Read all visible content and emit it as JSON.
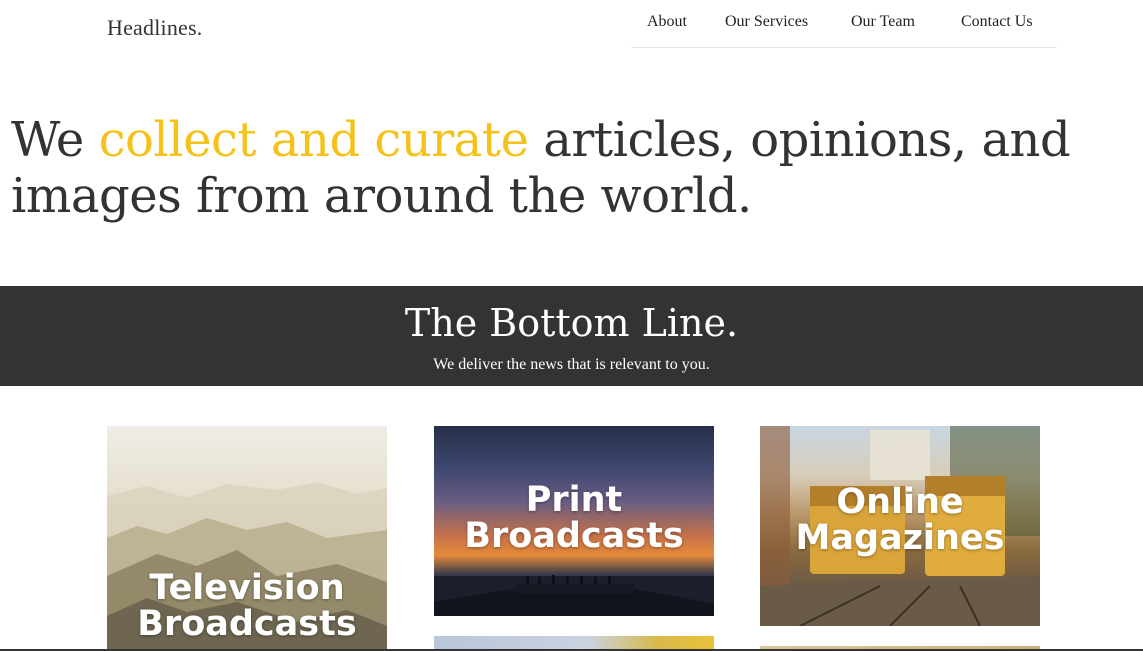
{
  "header": {
    "brand": "Headlines.",
    "nav": [
      "About",
      "Our Services",
      "Our Team",
      "Contact Us"
    ]
  },
  "hero": {
    "before": "We ",
    "accent": "collect and curate",
    "after": " articles, opinions, and images from around the world.",
    "accent_color": "#f5c21b"
  },
  "band": {
    "title": "The Bottom Line.",
    "subtitle": "We deliver the news that is relevant to you.",
    "background": "#333333"
  },
  "cards": [
    {
      "label": "Television Broadcasts"
    },
    {
      "label": "Print Broadcasts"
    },
    {
      "label": "Online Magazines"
    }
  ]
}
